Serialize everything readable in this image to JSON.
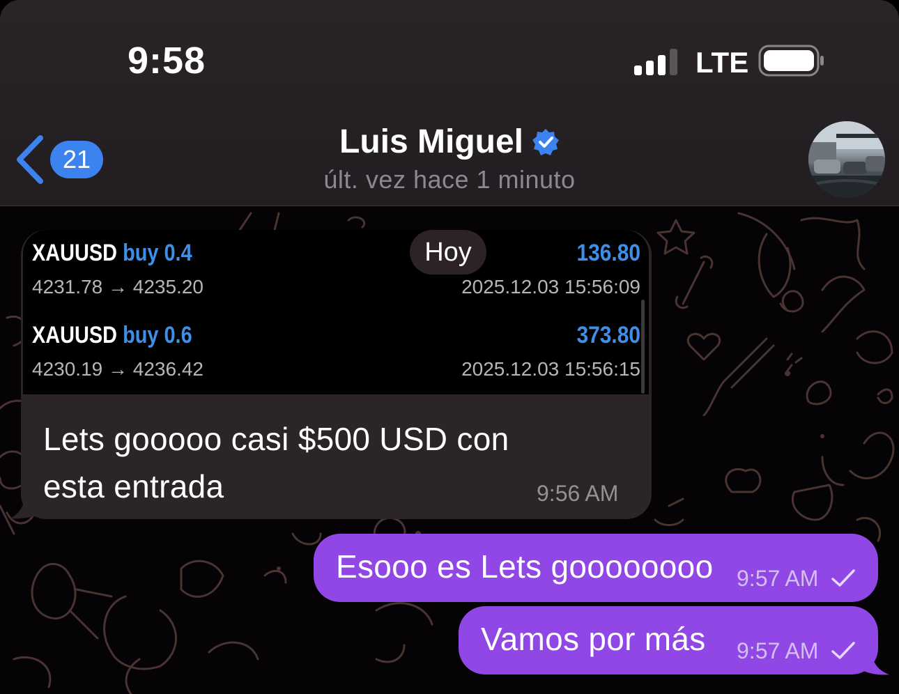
{
  "status_bar": {
    "time": "9:58",
    "network": "LTE"
  },
  "header": {
    "back_count": "21",
    "contact_name": "Luis Miguel",
    "last_seen": "últ. vez hace 1 minuto"
  },
  "date_pill": "Hoy",
  "trades": [
    {
      "symbol": "XAUUSD",
      "side": "buy 0.4",
      "profit": "136.80",
      "prices": "4231.78 → 4235.20",
      "time": "2025.12.03 15:56:09"
    },
    {
      "symbol": "XAUUSD",
      "side": "buy 0.6",
      "profit": "373.80",
      "prices": "4230.19 → 4236.42",
      "time": "2025.12.03 15:56:15"
    }
  ],
  "messages": [
    {
      "direction": "incoming",
      "line1": "Lets gooooo casi $500 USD con",
      "line2": "esta entrada",
      "time": "9:56 AM"
    },
    {
      "direction": "outgoing",
      "text": "Esooo es Lets goooooooo",
      "time": "9:57 AM"
    },
    {
      "direction": "outgoing",
      "text": "Vamos por más",
      "time": "9:57 AM"
    }
  ],
  "colors": {
    "accent": "#3c83f0",
    "outgoing_bubble": "#9147e6",
    "incoming_bubble": "#2c2527",
    "profit_blue": "#3d8fe8"
  }
}
